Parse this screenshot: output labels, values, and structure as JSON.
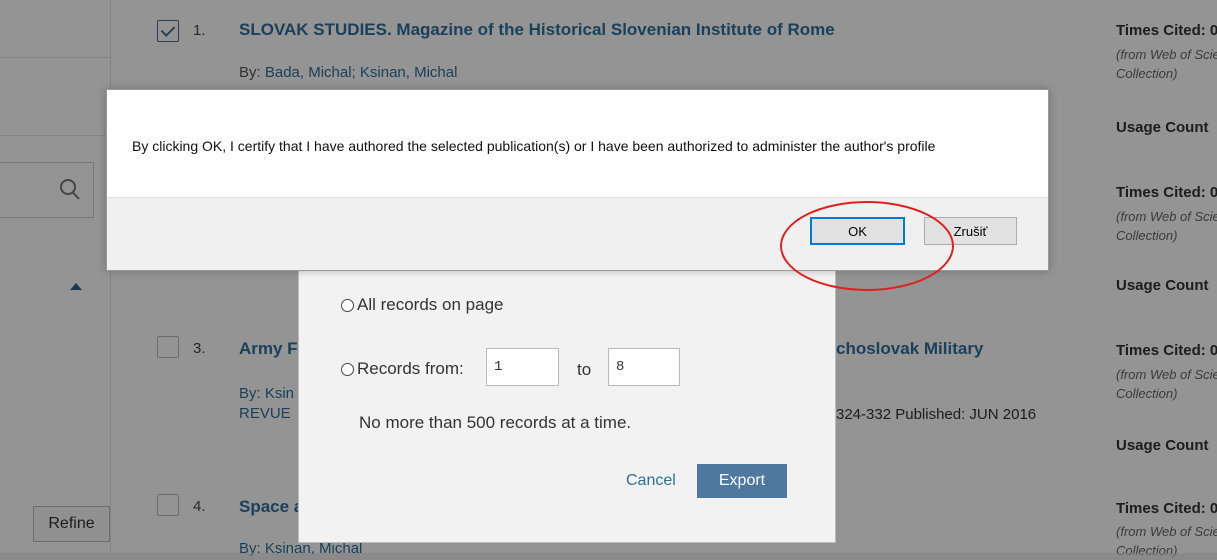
{
  "sidebar": {
    "refine_label": "Refine"
  },
  "records": [
    {
      "num": "1.",
      "title": "SLOVAK STUDIES. Magazine of the Historical Slovenian Institute of Rome",
      "by_label": "By: ",
      "authors": "Bada, Michal; Ksinan, Michal",
      "checked": true
    },
    {
      "num": "3.",
      "title_start": "Army F",
      "title_end": "choslovak Military",
      "by_partial": "By: Ksin",
      "source_partial": "REVUE",
      "pub_tail": "324-332  Published: JUN 2016",
      "checked": false
    },
    {
      "num": "4.",
      "title_start": "Space a",
      "by_partial": "By: Ksinan, Michal",
      "checked": false
    }
  ],
  "right_col": {
    "times_cited": "Times Cited: 0",
    "from_wos": "(from Web of Science Core",
    "collection": "Collection)",
    "usage_count": "Usage Count"
  },
  "export_dialog": {
    "option_all": "All records on page",
    "option_range": "Records from:",
    "from_value": "1",
    "to_label": "to",
    "to_value": "8",
    "limit_note": "No more than 500 records at a time.",
    "cancel_label": "Cancel",
    "export_label": "Export"
  },
  "confirm_dialog": {
    "message": "By clicking OK, I certify that I have authored the selected publication(s) or I have been authorized to administer the author's profile",
    "ok_label": "OK",
    "cancel_label": "Zrušiť"
  },
  "colors": {
    "link": "#2f6e9b",
    "annotation_ring": "#e0201f",
    "ok_focus": "#0078d7"
  }
}
